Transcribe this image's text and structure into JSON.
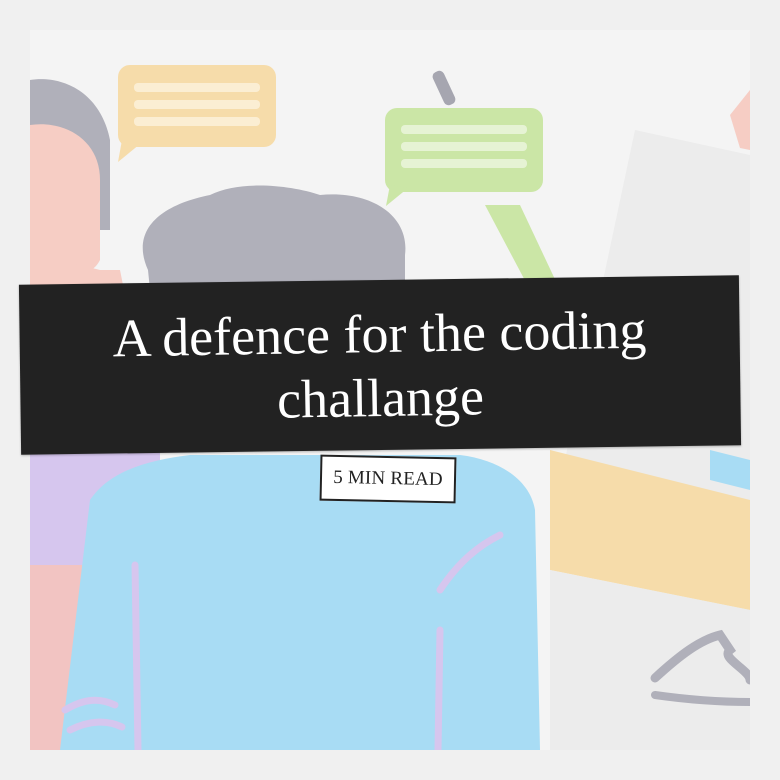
{
  "title": "A defence for the coding challange",
  "badge": "5 MIN READ",
  "colors": {
    "banner": "#222222",
    "banner_text": "#ffffff",
    "badge_bg": "#ffffff",
    "badge_border": "#222222",
    "illustration_bg": "#f4f4f4",
    "shirt_blue": "#a8dcf4",
    "hair_gray": "#b0b0ba",
    "bubble_orange": "#f6dcaa",
    "bubble_green": "#cbe6a6",
    "shirt_purple": "#d6c6ee",
    "skin": "#f6cdc4"
  }
}
